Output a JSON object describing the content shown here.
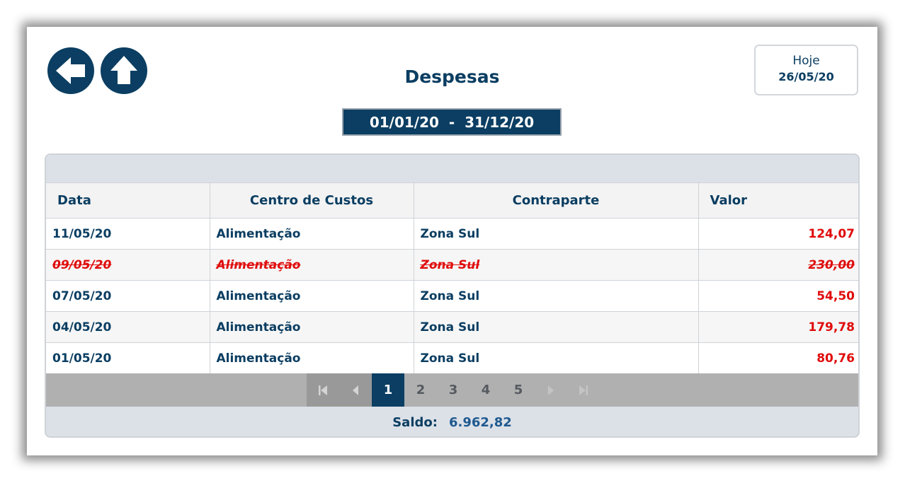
{
  "header": {
    "title": "Despesas",
    "today_label": "Hoje",
    "today_date": "26/05/20",
    "date_range": "01/01/20  -  31/12/20"
  },
  "nav": {
    "back_icon": "arrow-left-icon",
    "home_icon": "arrow-up-icon"
  },
  "table": {
    "columns": [
      "Data",
      "Centro de Custos",
      "Contraparte",
      "Valor"
    ],
    "rows": [
      {
        "data": "11/05/20",
        "centro": "Alimentação",
        "contraparte": "Zona Sul",
        "valor": "124,07",
        "cancelled": false
      },
      {
        "data": "09/05/20",
        "centro": "Alimentação",
        "contraparte": "Zona Sul",
        "valor": "230,00",
        "cancelled": true
      },
      {
        "data": "07/05/20",
        "centro": "Alimentação",
        "contraparte": "Zona Sul",
        "valor": "54,50",
        "cancelled": false
      },
      {
        "data": "04/05/20",
        "centro": "Alimentação",
        "contraparte": "Zona Sul",
        "valor": "179,78",
        "cancelled": false
      },
      {
        "data": "01/05/20",
        "centro": "Alimentação",
        "contraparte": "Zona Sul",
        "valor": "80,76",
        "cancelled": false
      }
    ]
  },
  "pager": {
    "pages": [
      "1",
      "2",
      "3",
      "4",
      "5"
    ],
    "current": "1"
  },
  "footer": {
    "saldo_label": "Saldo:",
    "saldo_value": "6.962,82"
  },
  "colors": {
    "primary": "#0b3e62",
    "negative": "#e00b0b",
    "grid_bg": "#dce1e8",
    "pager_bg": "#b0b0b0"
  }
}
